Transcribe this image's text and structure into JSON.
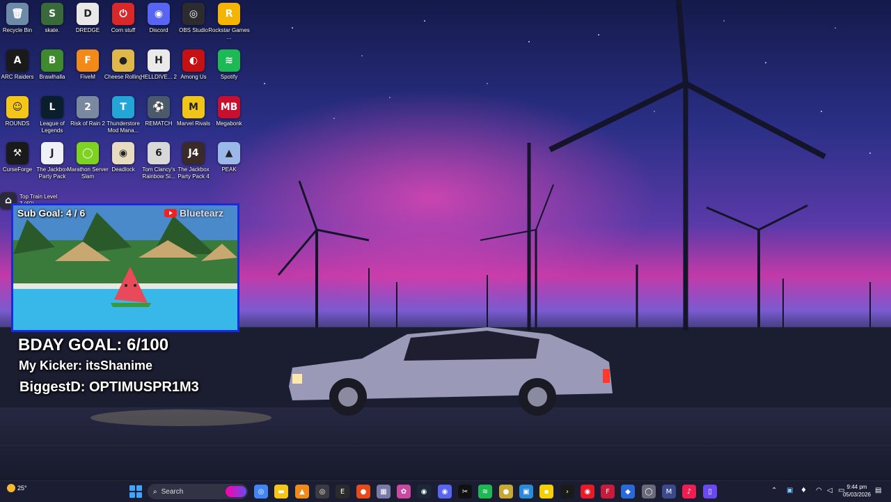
{
  "desktop": {
    "icons": [
      {
        "label": "Recycle Bin",
        "glyph": "🗑",
        "color": "#6d8aa8"
      },
      {
        "label": "skate.",
        "glyph": "S",
        "color": "#3a6a3a"
      },
      {
        "label": "DREDGE",
        "glyph": "D",
        "color": "#e8e8e8"
      },
      {
        "label": "Corn stuff",
        "glyph": "⏻",
        "color": "#d8282a"
      },
      {
        "label": "Discord",
        "glyph": "◉",
        "color": "#5865f2"
      },
      {
        "label": "OBS Studio",
        "glyph": "◎",
        "color": "#2b2b30"
      },
      {
        "label": "Rockstar Games ...",
        "glyph": "R",
        "color": "#f4b400"
      },
      {
        "label": "ARC Raiders",
        "glyph": "A",
        "color": "#1a1a1a"
      },
      {
        "label": "Brawlhalla",
        "glyph": "B",
        "color": "#3f8a2c"
      },
      {
        "label": "FiveM",
        "glyph": "F",
        "color": "#f28a1a"
      },
      {
        "label": "Cheese Rolling",
        "glyph": "●",
        "color": "#e0b84a"
      },
      {
        "label": "HELLDIVE... 2",
        "glyph": "H",
        "color": "#eaeaea"
      },
      {
        "label": "Among Us",
        "glyph": "◐",
        "color": "#c51111"
      },
      {
        "label": "Spotify",
        "glyph": "≋",
        "color": "#1db954"
      },
      {
        "label": "ROUNDS",
        "glyph": "☺",
        "color": "#f5c518"
      },
      {
        "label": "League of Legends",
        "glyph": "L",
        "color": "#0a1f2e"
      },
      {
        "label": "Risk of Rain 2",
        "glyph": "2",
        "color": "#7a88a0"
      },
      {
        "label": "Thunderstore Mod Mana...",
        "glyph": "T",
        "color": "#23a6d5"
      },
      {
        "label": "REMATCH",
        "glyph": "⚽",
        "color": "#4a5a6a"
      },
      {
        "label": "Marvel Rivals",
        "glyph": "M",
        "color": "#f0c419"
      },
      {
        "label": "Megabonk",
        "glyph": "MB",
        "color": "#c8102e"
      },
      {
        "label": "CurseForge",
        "glyph": "⚒",
        "color": "#1a1a1a"
      },
      {
        "label": "The Jackbox Party Pack",
        "glyph": "J",
        "color": "#eef2f8"
      },
      {
        "label": "Marathon Server Slam",
        "glyph": "◯",
        "color": "#7ed321"
      },
      {
        "label": "Deadlock",
        "glyph": "◉",
        "color": "#e8dcc0"
      },
      {
        "label": "Tom Clancy's Rainbow Si...",
        "glyph": "6",
        "color": "#d8d8d8"
      },
      {
        "label": "The Jackbox Party Pack 4",
        "glyph": "J4",
        "color": "#3a2a2a"
      },
      {
        "label": "PEAK",
        "glyph": "▲",
        "color": "#9ab8e8"
      },
      {
        "label": "Top Train Level 3 (60)",
        "glyph": "⌂",
        "color": "#2a2a3a"
      }
    ]
  },
  "overlay": {
    "sub_goal": "Sub Goal:  4 / 6",
    "channel": "Bluetearz",
    "bday_goal": "BDAY GOAL: 6/100",
    "kicker": "My Kicker: itsShanime",
    "biggest": "BiggestD: OPTIMUSPR1M3"
  },
  "taskbar": {
    "weather_temp": "25°",
    "search_label": "Search",
    "time": "9:44 pm",
    "date": "05/03/2026",
    "pinned": [
      {
        "name": "chrome-icon",
        "glyph": "◎",
        "color": "#4285f4"
      },
      {
        "name": "file-explorer-icon",
        "glyph": "▬",
        "color": "#f5c518"
      },
      {
        "name": "vlc-icon",
        "glyph": "▲",
        "color": "#f08a1a"
      },
      {
        "name": "obs-icon",
        "glyph": "◎",
        "color": "#3a3a40"
      },
      {
        "name": "epic-games-icon",
        "glyph": "E",
        "color": "#2a2a2a"
      },
      {
        "name": "fire-app-icon",
        "glyph": "●",
        "color": "#e84a1a"
      },
      {
        "name": "app-tile-icon",
        "glyph": "▦",
        "color": "#7a7aaa"
      },
      {
        "name": "spiral-app-icon",
        "glyph": "✿",
        "color": "#c84aa0"
      },
      {
        "name": "steam-icon",
        "glyph": "◉",
        "color": "#1b2838"
      },
      {
        "name": "discord-icon",
        "glyph": "◉",
        "color": "#5865f2"
      },
      {
        "name": "capcut-icon",
        "glyph": "✂",
        "color": "#111111"
      },
      {
        "name": "spotify-icon",
        "glyph": "≋",
        "color": "#1db954"
      },
      {
        "name": "cheese-app-icon",
        "glyph": "●",
        "color": "#c8a830"
      },
      {
        "name": "photos-icon",
        "glyph": "▣",
        "color": "#2a8ad8"
      },
      {
        "name": "sticky-notes-icon",
        "glyph": "▪",
        "color": "#f5d000"
      },
      {
        "name": "terminal-icon",
        "glyph": "›",
        "color": "#1a1a1a"
      },
      {
        "name": "record-icon",
        "glyph": "◉",
        "color": "#e81a2a"
      },
      {
        "name": "f-app-icon",
        "glyph": "F",
        "color": "#c81a3a"
      },
      {
        "name": "diamond-app-icon",
        "glyph": "◆",
        "color": "#2a6ad8"
      },
      {
        "name": "circle-app-icon",
        "glyph": "◯",
        "color": "#6a6a7a"
      },
      {
        "name": "megabonk-app-icon",
        "glyph": "M",
        "color": "#3a4a8a"
      },
      {
        "name": "tiktok-icon",
        "glyph": "♪",
        "color": "#ee1d52"
      },
      {
        "name": "phone-link-icon",
        "glyph": "▯",
        "color": "#6a4af0"
      }
    ]
  }
}
